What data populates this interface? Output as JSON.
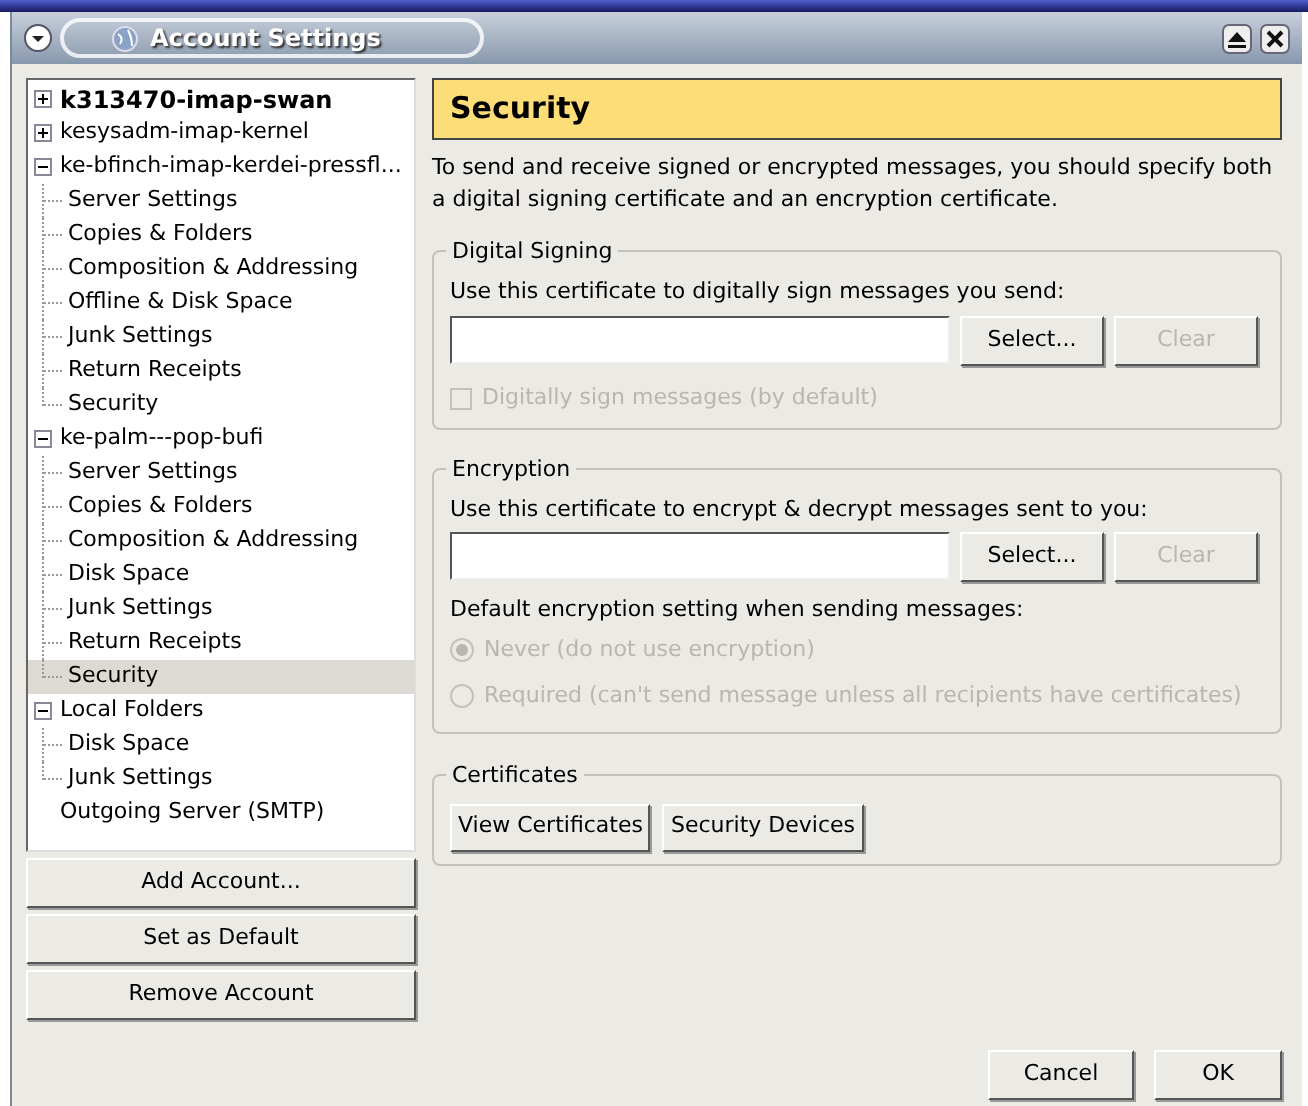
{
  "window": {
    "title": "Account Settings"
  },
  "tree": [
    {
      "label": "k313470-imap-swan",
      "default": true,
      "expanded": false,
      "selected": false
    },
    {
      "label": "kesysadm-imap-kernel",
      "default": false,
      "expanded": false,
      "selected": false
    },
    {
      "label": "ke-bfinch-imap-kerdei-pressfl...",
      "default": false,
      "expanded": true,
      "selected": false,
      "children": [
        {
          "label": "Server Settings",
          "selected": false
        },
        {
          "label": "Copies & Folders",
          "selected": false
        },
        {
          "label": "Composition & Addressing",
          "selected": false
        },
        {
          "label": "Offline & Disk Space",
          "selected": false
        },
        {
          "label": "Junk Settings",
          "selected": false
        },
        {
          "label": "Return Receipts",
          "selected": false
        },
        {
          "label": "Security",
          "selected": false
        }
      ]
    },
    {
      "label": "ke-palm---pop-bufi",
      "default": false,
      "expanded": true,
      "selected": false,
      "children": [
        {
          "label": "Server Settings",
          "selected": false
        },
        {
          "label": "Copies & Folders",
          "selected": false
        },
        {
          "label": "Composition & Addressing",
          "selected": false
        },
        {
          "label": "Disk Space",
          "selected": false
        },
        {
          "label": "Junk Settings",
          "selected": false
        },
        {
          "label": "Return Receipts",
          "selected": false
        },
        {
          "label": "Security",
          "selected": true
        }
      ]
    },
    {
      "label": "Local Folders",
      "default": false,
      "expanded": true,
      "selected": false,
      "children": [
        {
          "label": "Disk Space",
          "selected": false
        },
        {
          "label": "Junk Settings",
          "selected": false
        }
      ]
    },
    {
      "label": "Outgoing Server (SMTP)",
      "default": false,
      "selected": false
    }
  ],
  "account_buttons": [
    "Add Account...",
    "Set as Default",
    "Remove Account"
  ],
  "panel": {
    "title": "Security",
    "description": "To send and receive signed or encrypted messages, you should specify both a digital signing certificate and an encryption certificate.",
    "digital_signing": {
      "legend": "Digital Signing",
      "prompt": "Use this certificate to digitally sign messages you send:",
      "select": "Select...",
      "clear": "Clear",
      "clear_disabled": true,
      "checkbox": {
        "label": "Digitally sign messages (by default)",
        "checked": false,
        "disabled": true
      }
    },
    "encryption": {
      "legend": "Encryption",
      "prompt": "Use this certificate to encrypt & decrypt messages sent to you:",
      "select": "Select...",
      "clear": "Clear",
      "clear_disabled": true,
      "setting_label": "Default encryption setting when sending messages:",
      "options": [
        {
          "label": "Never (do not use encryption)",
          "selected": true,
          "disabled": true
        },
        {
          "label": "Required (can't send message unless all recipients have certificates)",
          "selected": false,
          "disabled": true
        }
      ]
    },
    "certificates": {
      "legend": "Certificates",
      "buttons": [
        "View Certificates",
        "Security Devices"
      ]
    }
  },
  "dialog_buttons": [
    "Cancel",
    "OK"
  ]
}
